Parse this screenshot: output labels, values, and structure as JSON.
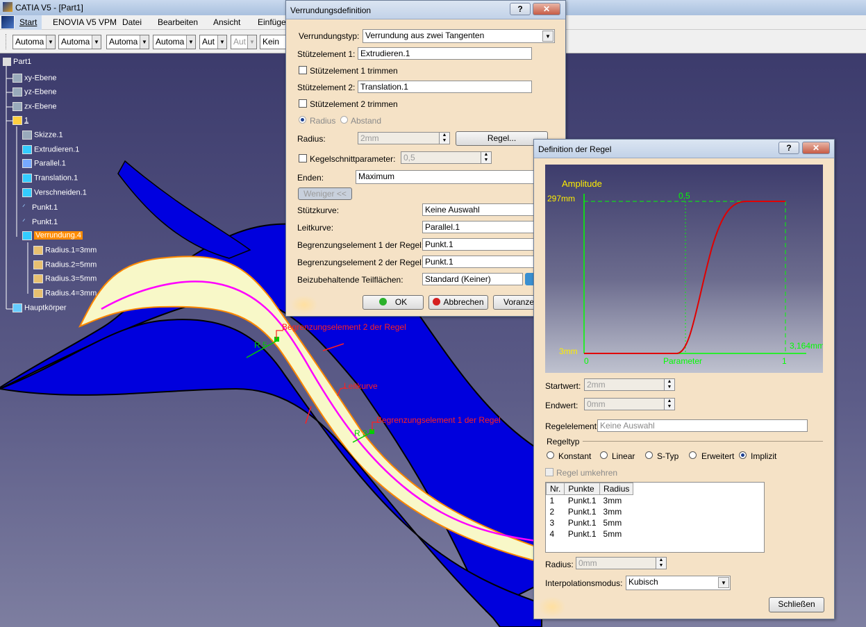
{
  "window": {
    "title": "CATIA V5 - [Part1]"
  },
  "menu": [
    "Start",
    "ENOVIA V5 VPM",
    "Datei",
    "Bearbeiten",
    "Ansicht",
    "Einfüge"
  ],
  "toolbar": {
    "combos": [
      "Automa",
      "Automa",
      "Automa",
      "Automa",
      "Aut",
      "Aut",
      "Kein"
    ]
  },
  "tree": {
    "root": "Part1",
    "items": [
      "xy-Ebene",
      "yz-Ebene",
      "zx-Ebene",
      "1",
      "Skizze.1",
      "Extrudieren.1",
      "Parallel.1",
      "Translation.1",
      "Verschneiden.1",
      "Punkt.1",
      "Punkt.1",
      "Verrundung.4",
      "Radius.1=3mm",
      "Radius.2=5mm",
      "Radius.3=5mm",
      "Radius.4=3mm",
      "Hauptkörper"
    ]
  },
  "annotations": {
    "limit2": "Begrenzungselement 2 der Regel",
    "limit1": "Begrenzungselement 1 der Regel",
    "spine": "Leitkurve",
    "r5": "R 5",
    "r3": "R 3"
  },
  "fillet_dialog": {
    "title": "Verrundungsdefinition",
    "type_label": "Verrundungstyp:",
    "type_value": "Verrundung aus zwei Tangenten",
    "support1_label": "Stützelement 1:",
    "support1_value": "Extrudieren.1",
    "trim1_label": "Stützelement 1 trimmen",
    "support2_label": "Stützelement 2:",
    "support2_value": "Translation.1",
    "trim2_label": "Stützelement 2 trimmen",
    "radius_opt": "Radius",
    "chord_opt": "Abstand",
    "radius_label": "Radius:",
    "radius_value": "2mm",
    "law_button": "Regel...",
    "conic_label": "Kegelschnittparameter:",
    "conic_value": "0,5",
    "ends_label": "Enden:",
    "ends_value": "Maximum",
    "less_button": "Weniger <<",
    "spine_label": "Stützkurve:",
    "spine_value": "Keine Auswahl",
    "guide_label": "Leitkurve:",
    "guide_value": "Parallel.1",
    "lim1_label": "Begrenzungselement 1 der Regel:",
    "lim1_value": "Punkt.1",
    "lim2_label": "Begrenzungselement 2 der Regel:",
    "lim2_value": "Punkt.1",
    "faces_label": "Beizubehaltende Teilflächen:",
    "faces_value": "Standard (Keiner)",
    "ok": "OK",
    "cancel": "Abbrechen",
    "preview": "Voranze"
  },
  "law_dialog": {
    "title": "Definition der Regel",
    "graph": {
      "amplitude": "Amplitude",
      "max": "297mm",
      "min": "3mm",
      "half": "0,5",
      "zero": "0",
      "one": "1",
      "param": "Parameter",
      "length": "3,164mm"
    },
    "start_label": "Startwert:",
    "start_value": "2mm",
    "end_label": "Endwert:",
    "end_value": "0mm",
    "law_elem_label": "Regelelement:",
    "law_elem_value": "Keine Auswahl",
    "law_type_label": "Regeltyp",
    "types": [
      "Konstant",
      "Linear",
      "S-Typ",
      "Erweitert",
      "Implizit"
    ],
    "invert_label": "Regel umkehren",
    "table": {
      "headers": [
        "Nr.",
        "Punkte",
        "Radius"
      ],
      "rows": [
        [
          "1",
          "Punkt.1",
          "3mm"
        ],
        [
          "2",
          "Punkt.1",
          "3mm"
        ],
        [
          "3",
          "Punkt.1",
          "5mm"
        ],
        [
          "4",
          "Punkt.1",
          "5mm"
        ]
      ]
    },
    "radius_label": "Radius:",
    "radius_value": "0mm",
    "interp_label": "Interpolationsmodus:",
    "interp_value": "Kubisch",
    "close": "Schließen"
  }
}
